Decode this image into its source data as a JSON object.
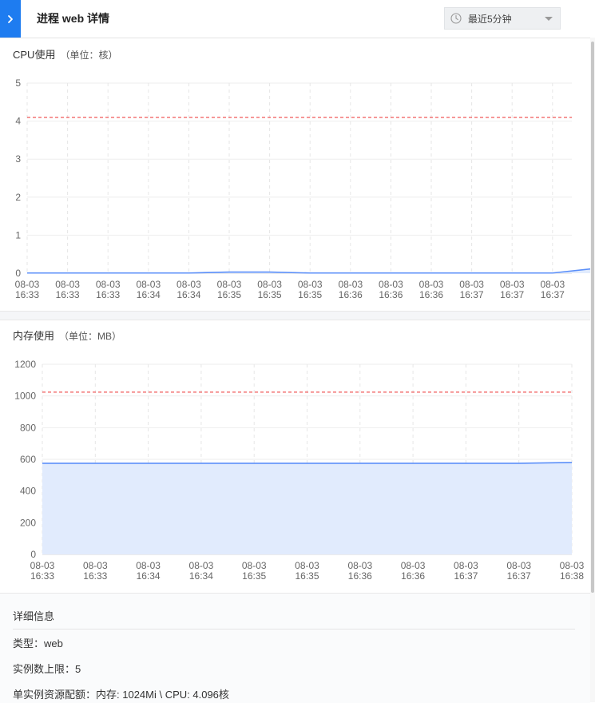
{
  "header": {
    "title": "进程 web 详情",
    "time_range": "最近5分钟"
  },
  "cpu_panel": {
    "title": "CPU使用",
    "unit": "（单位：核）"
  },
  "mem_panel": {
    "title": "内存使用",
    "unit": "（单位：MB）"
  },
  "details": {
    "title": "详细信息",
    "type_label": "类型：",
    "type_value": "web",
    "limit_label": "实例数上限：",
    "limit_value": "5",
    "resource_label": "单实例资源配额：",
    "resource_value": "内存: 1024Mi \\ CPU: 4.096核"
  },
  "colors": {
    "accent": "#1e7cf0",
    "series_line": "#5b8ff9",
    "series_fill": "#e1ebfd",
    "limit_line": "#f05a5a"
  },
  "chart_data": [
    {
      "type": "area",
      "name": "cpu",
      "x": [
        "08-03 16:33",
        "08-03 16:33",
        "08-03 16:33",
        "08-03 16:34",
        "08-03 16:34",
        "08-03 16:35",
        "08-03 16:35",
        "08-03 16:35",
        "08-03 16:36",
        "08-03 16:36",
        "08-03 16:36",
        "08-03 16:37",
        "08-03 16:37",
        "08-03 16:37",
        ""
      ],
      "values": [
        0.005,
        0.005,
        0.005,
        0.005,
        0.005,
        0.03,
        0.03,
        0.005,
        0.005,
        0.005,
        0.005,
        0.005,
        0.005,
        0.005,
        0.12
      ],
      "limit": 4.096,
      "ylim": [
        0,
        5
      ],
      "yticks": [
        0,
        1,
        2,
        3,
        4,
        5
      ],
      "xtick_labels": [
        [
          "08-03",
          "16:33"
        ],
        [
          "08-03",
          "16:33"
        ],
        [
          "08-03",
          "16:33"
        ],
        [
          "08-03",
          "16:34"
        ],
        [
          "08-03",
          "16:34"
        ],
        [
          "08-03",
          "16:35"
        ],
        [
          "08-03",
          "16:35"
        ],
        [
          "08-03",
          "16:35"
        ],
        [
          "08-03",
          "16:36"
        ],
        [
          "08-03",
          "16:36"
        ],
        [
          "08-03",
          "16:36"
        ],
        [
          "08-03",
          "16:37"
        ],
        [
          "08-03",
          "16:37"
        ],
        [
          "08-03",
          "16:37"
        ]
      ],
      "grid": true
    },
    {
      "type": "area",
      "name": "memory",
      "x": [
        "08-03 16:33",
        "08-03 16:33",
        "08-03 16:34",
        "08-03 16:34",
        "08-03 16:35",
        "08-03 16:35",
        "08-03 16:36",
        "08-03 16:36",
        "08-03 16:37",
        "08-03 16:37",
        "08-03 16:38"
      ],
      "values": [
        575,
        575,
        575,
        575,
        575,
        575,
        575,
        575,
        575,
        575,
        580
      ],
      "limit": 1024,
      "ylim": [
        0,
        1200
      ],
      "yticks": [
        0,
        200,
        400,
        600,
        800,
        1000,
        1200
      ],
      "xtick_labels": [
        [
          "08-03",
          "16:33"
        ],
        [
          "08-03",
          "16:33"
        ],
        [
          "08-03",
          "16:34"
        ],
        [
          "08-03",
          "16:34"
        ],
        [
          "08-03",
          "16:35"
        ],
        [
          "08-03",
          "16:35"
        ],
        [
          "08-03",
          "16:36"
        ],
        [
          "08-03",
          "16:36"
        ],
        [
          "08-03",
          "16:37"
        ],
        [
          "08-03",
          "16:37"
        ],
        [
          "08-03",
          "16:38"
        ]
      ],
      "grid": true
    }
  ]
}
